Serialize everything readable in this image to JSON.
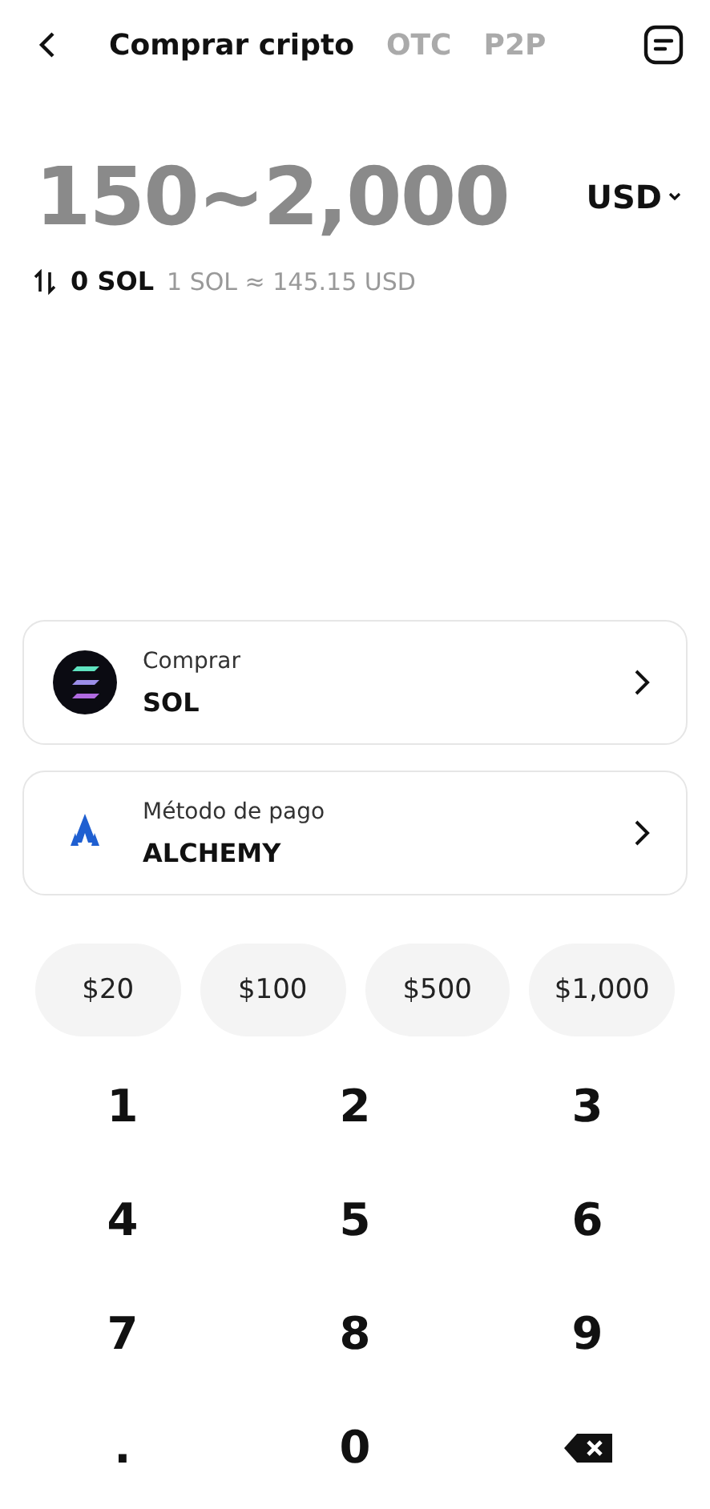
{
  "header": {
    "tabs": [
      {
        "label": "Comprar cripto",
        "selected": true
      },
      {
        "label": "OTC",
        "selected": false
      },
      {
        "label": "P2P",
        "selected": false
      }
    ]
  },
  "amount": {
    "placeholder": "150~2,000",
    "currency": "USD"
  },
  "conversion": {
    "value": "0 SOL",
    "rate": "1 SOL ≈ 145.15 USD"
  },
  "cards": [
    {
      "kind": "coin",
      "label": "Comprar",
      "value": "SOL"
    },
    {
      "kind": "provider",
      "label": "Método de pago",
      "value": "ALCHEMY"
    }
  ],
  "presets": [
    "$20",
    "$100",
    "$500",
    "$1,000"
  ],
  "keypad": [
    {
      "kind": "key",
      "label": "1"
    },
    {
      "kind": "key",
      "label": "2"
    },
    {
      "kind": "key",
      "label": "3"
    },
    {
      "kind": "key",
      "label": "4"
    },
    {
      "kind": "key",
      "label": "5"
    },
    {
      "kind": "key",
      "label": "6"
    },
    {
      "kind": "key",
      "label": "7"
    },
    {
      "kind": "key",
      "label": "8"
    },
    {
      "kind": "key",
      "label": "9"
    },
    {
      "kind": "key",
      "label": "."
    },
    {
      "kind": "key",
      "label": "0"
    },
    {
      "kind": "backspace"
    }
  ]
}
